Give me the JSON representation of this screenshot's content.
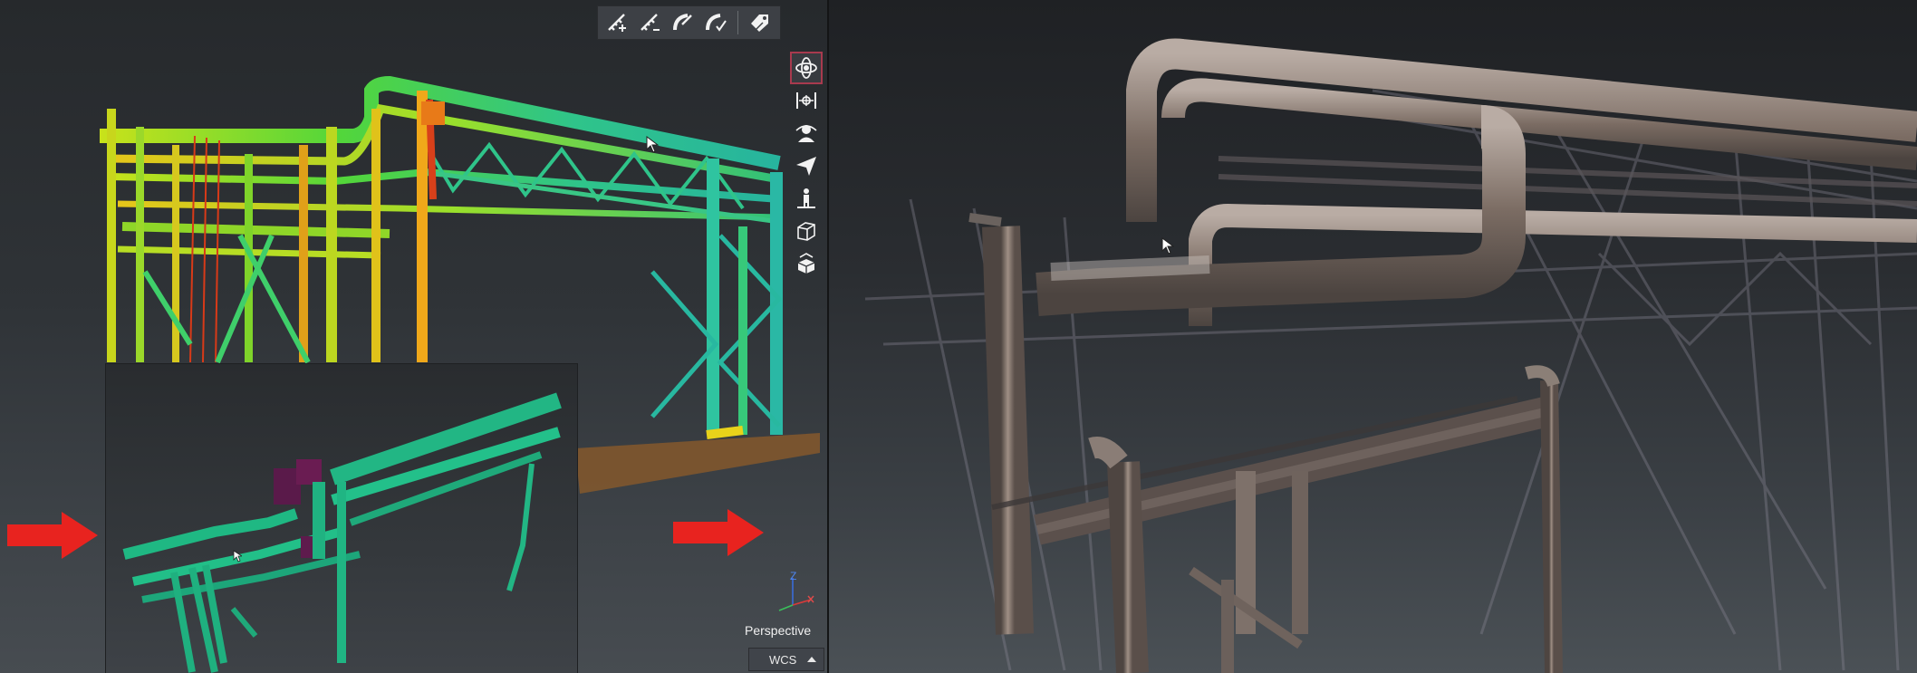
{
  "left_viewport": {
    "top_toolbar": {
      "tools": [
        {
          "icon": "add-measure-icon"
        },
        {
          "icon": "measure-icon"
        },
        {
          "icon": "pipe-edit-icon"
        },
        {
          "icon": "pipe-check-icon"
        },
        {
          "icon": "tags-icon"
        }
      ]
    },
    "side_toolbar": {
      "tools": [
        {
          "icon": "orbit-icon",
          "active": true
        },
        {
          "icon": "pan-center-icon"
        },
        {
          "icon": "observer-icon"
        },
        {
          "icon": "fly-icon"
        },
        {
          "icon": "walk-icon"
        },
        {
          "icon": "box-view-icon"
        },
        {
          "icon": "section-box-icon"
        }
      ]
    },
    "axis": {
      "z": "Z"
    },
    "projection_label": "Perspective",
    "coordinate_system": "WCS"
  },
  "colors": {
    "accent_red": "#e8231f",
    "active_tool_border": "#a83a4e",
    "pipe_green": "#1fbf86"
  }
}
